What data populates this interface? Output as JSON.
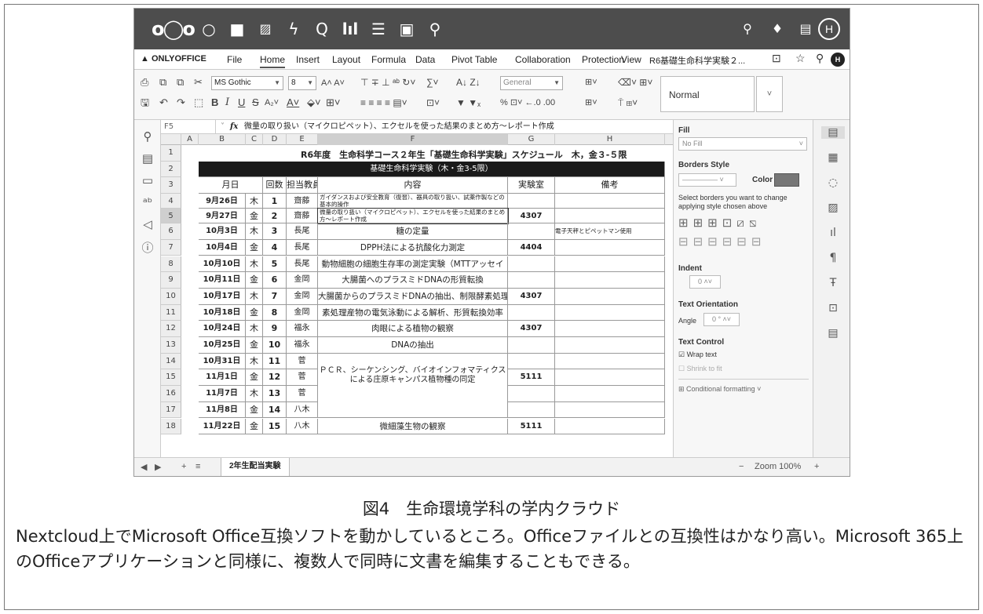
{
  "nextcloud": {
    "avatar_letter": "H",
    "icons": [
      "nextcloud-logo-icon",
      "dashboard-icon",
      "files-icon",
      "photos-icon",
      "activity-icon",
      "search-app-icon",
      "deck-icon",
      "tasks-icon",
      "notes-icon",
      "maps-icon"
    ]
  },
  "menubar": {
    "logo": "ONLYOFFICE",
    "items": [
      "File",
      "Home",
      "Insert",
      "Layout",
      "Formula",
      "Data",
      "Pivot Table",
      "Collaboration",
      "Protection",
      "View"
    ],
    "active": "Home",
    "doc_title": "R6基礎生命科学実験２...",
    "user_letter": "H"
  },
  "toolbar": {
    "font_name": "MS Gothic",
    "font_size": "8",
    "number_format": "General",
    "style_name": "Normal"
  },
  "formula_bar": {
    "cell_ref": "F5",
    "fx": "fx",
    "content": "微量の取り扱い（マイクロピペット）、エクセルを使った結果のまとめ方～レポート作成"
  },
  "columns": [
    "A",
    "B",
    "C",
    "D",
    "E",
    "F",
    "G",
    "H"
  ],
  "sheet": {
    "title": "R6年度　生命科学コース２年生「基礎生命科学実験」スケジュール　木，金３-５限",
    "banner": "基礎生命科学実験（木・金3-5限）",
    "headers": [
      "月日",
      "",
      "回数",
      "担当教員",
      "内容",
      "実験室",
      "備考"
    ],
    "rows": [
      {
        "num": "4",
        "date": "9月26日",
        "day": "木",
        "n": "1",
        "teacher": "齋藤",
        "content": "ガイダンスおよび安全教育（復習）、器具の取り扱い、試薬作製などの基本的操作",
        "room": "",
        "note": ""
      },
      {
        "num": "5",
        "date": "9月27日",
        "day": "金",
        "n": "2",
        "teacher": "齋藤",
        "content": "微量の取り扱い（マイクロピペット）、エクセルを使った結果のまとめ方～レポート作成",
        "room": "4307",
        "note": ""
      },
      {
        "num": "6",
        "date": "10月3日",
        "day": "木",
        "n": "3",
        "teacher": "長尾",
        "content": "糖の定量",
        "room": "",
        "note": "電子天秤とピペットマン使用"
      },
      {
        "num": "7",
        "date": "10月4日",
        "day": "金",
        "n": "4",
        "teacher": "長尾",
        "content": "DPPH法による抗酸化力測定",
        "room": "4404",
        "note": ""
      },
      {
        "num": "8",
        "date": "10月10日",
        "day": "木",
        "n": "5",
        "teacher": "長尾",
        "content": "動物細胞の細胞生存率の測定実験（MTTアッセイ",
        "room": "",
        "note": ""
      },
      {
        "num": "9",
        "date": "10月11日",
        "day": "金",
        "n": "6",
        "teacher": "金岡",
        "content": "大腸菌へのプラスミドDNAの形質転換",
        "room": "",
        "note": ""
      },
      {
        "num": "10",
        "date": "10月17日",
        "day": "木",
        "n": "7",
        "teacher": "金岡",
        "content": "大腸菌からのプラスミドDNAの抽出、制限酵素処理",
        "room": "4307",
        "note": ""
      },
      {
        "num": "11",
        "date": "10月18日",
        "day": "金",
        "n": "8",
        "teacher": "金岡",
        "content": "素処理産物の電気泳動による解析、形質転換効率",
        "room": "",
        "note": ""
      },
      {
        "num": "12",
        "date": "10月24日",
        "day": "木",
        "n": "9",
        "teacher": "福永",
        "content": "肉眼による植物の観察",
        "room": "4307",
        "note": ""
      },
      {
        "num": "13",
        "date": "10月25日",
        "day": "金",
        "n": "10",
        "teacher": "福永",
        "content": "DNAの抽出",
        "room": "",
        "note": ""
      },
      {
        "num": "14",
        "date": "10月31日",
        "day": "木",
        "n": "11",
        "teacher": "菅",
        "content": "",
        "room": "",
        "note": ""
      },
      {
        "num": "15",
        "date": "11月1日",
        "day": "金",
        "n": "12",
        "teacher": "菅",
        "content": "ＰＣＲ、シーケンシング、バイオインフォマティクスによる庄原キャンパス植物種の同定",
        "room": "5111",
        "note": ""
      },
      {
        "num": "16",
        "date": "11月7日",
        "day": "木",
        "n": "13",
        "teacher": "菅",
        "content": "",
        "room": "",
        "note": ""
      },
      {
        "num": "17",
        "date": "11月8日",
        "day": "金",
        "n": "14",
        "teacher": "八木",
        "content": "",
        "room": "",
        "note": ""
      },
      {
        "num": "18",
        "date": "11月22日",
        "day": "金",
        "n": "15",
        "teacher": "八木",
        "content": "微細藻生物の観察",
        "room": "5111",
        "note": ""
      }
    ]
  },
  "right_panel": {
    "fill_label": "Fill",
    "fill_value": "No Fill",
    "borders_label": "Borders Style",
    "color_label": "Color",
    "borders_hint": "Select borders you want to change applying style chosen above",
    "indent_label": "Indent",
    "indent_value": "0",
    "orientation_label": "Text Orientation",
    "angle_label": "Angle",
    "angle_value": "0 °",
    "control_label": "Text Control",
    "wrap_label": "Wrap text",
    "shrink_label": "Shrink to fit",
    "cond_label": "Conditional formatting"
  },
  "statusbar": {
    "sheet_name": "2年生配当実験",
    "zoom": "Zoom 100%"
  },
  "caption": "図4　生命環境学科の学内クラウド",
  "body_text": "Nextcloud上でMicrosoft Office互換ソフトを動かしているところ。Officeファイルとの互換性はかなり高い。Microsoft 365上のOfficeアプリケーションと同様に、複数人で同時に文書を編集することもできる。"
}
